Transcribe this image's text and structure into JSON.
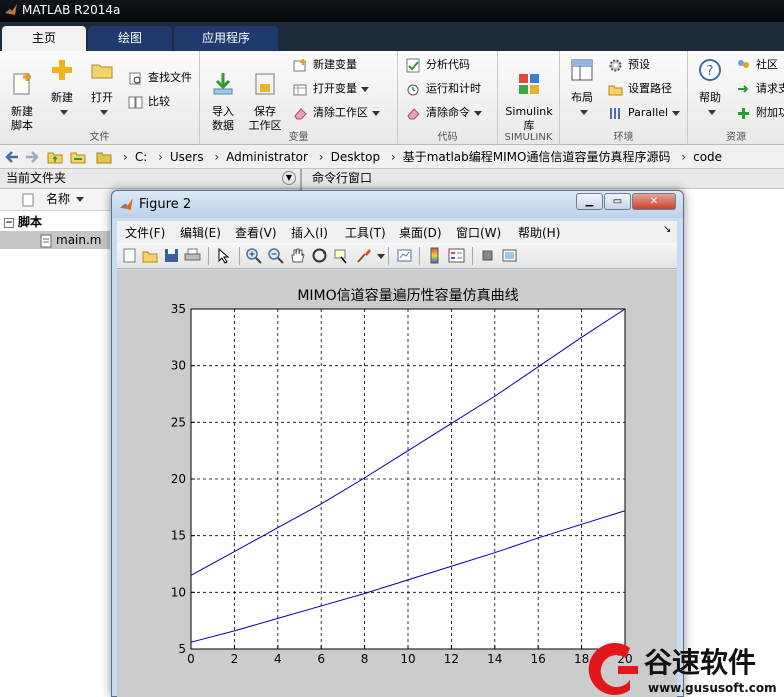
{
  "app": {
    "title": "MATLAB R2014a"
  },
  "tabs": [
    {
      "label": "主页"
    },
    {
      "label": "绘图"
    },
    {
      "label": "应用程序"
    }
  ],
  "ribbon": {
    "file_group": {
      "label": "文件",
      "new_script": "新建\n脚本",
      "new": "新建",
      "open": "打开",
      "find_files": "查找文件",
      "compare": "比较"
    },
    "variable_group": {
      "label": "变量",
      "import_data": "导入\n数据",
      "save_workspace": "保存\n工作区",
      "new_variable": "新建变量",
      "open_variable": "打开变量",
      "clear_workspace": "清除工作区"
    },
    "code_group": {
      "label": "代码",
      "analyze_code": "分析代码",
      "run_and_time": "运行和计时",
      "clear_commands": "清除命令"
    },
    "simulink_group": {
      "label": "SIMULINK",
      "simulink_library": "Simulink\n库"
    },
    "environment_group": {
      "label": "环境",
      "layout": "布局",
      "preferences": "预设",
      "set_path": "设置路径",
      "parallel": "Parallel"
    },
    "resources_group": {
      "label": "资源",
      "help": "帮助",
      "community": "社区",
      "request_support": "请求支",
      "add_ons": "附加功"
    }
  },
  "address_bar": {
    "path": [
      "C:",
      "Users",
      "Administrator",
      "Desktop",
      "基于matlab编程MIMO通信信道容量仿真程序源码",
      "code"
    ]
  },
  "current_folder": {
    "title": "当前文件夹",
    "column_name": "名称",
    "tree": [
      {
        "label": "脚本"
      },
      {
        "label": "main.m"
      }
    ]
  },
  "command_window": {
    "title": "命令行窗口"
  },
  "figure": {
    "title": "Figure 2",
    "menus": [
      "文件(F)",
      "编辑(E)",
      "查看(V)",
      "插入(I)",
      "工具(T)",
      "桌面(D)",
      "窗口(W)",
      "帮助(H)"
    ]
  },
  "chart_data": {
    "type": "line",
    "title": "MIMO信道容量遍历性容量仿真曲线",
    "xlabel": "",
    "ylabel": "",
    "xlim": [
      0,
      20
    ],
    "ylim": [
      5,
      35
    ],
    "xticks": [
      0,
      2,
      4,
      6,
      8,
      10,
      12,
      14,
      16,
      18,
      20
    ],
    "yticks": [
      5,
      10,
      15,
      20,
      25,
      30,
      35
    ],
    "grid": true,
    "grid_style": "dashed",
    "line_color": "#0000aa",
    "series": [
      {
        "x": [
          0,
          2,
          4,
          6,
          8,
          10,
          12,
          14,
          16,
          18,
          20
        ],
        "values": [
          11.5,
          13.6,
          15.7,
          17.8,
          20.1,
          22.5,
          24.9,
          27.3,
          29.9,
          32.5,
          35.0
        ]
      },
      {
        "x": [
          0,
          2,
          4,
          6,
          8,
          10,
          12,
          14,
          16,
          18,
          20
        ],
        "values": [
          5.6,
          6.6,
          7.7,
          8.8,
          9.9,
          11.1,
          12.3,
          13.5,
          14.8,
          16.0,
          17.2
        ]
      }
    ]
  },
  "watermark": {
    "brand": "谷速软件",
    "url": "www.gususoft.com"
  }
}
